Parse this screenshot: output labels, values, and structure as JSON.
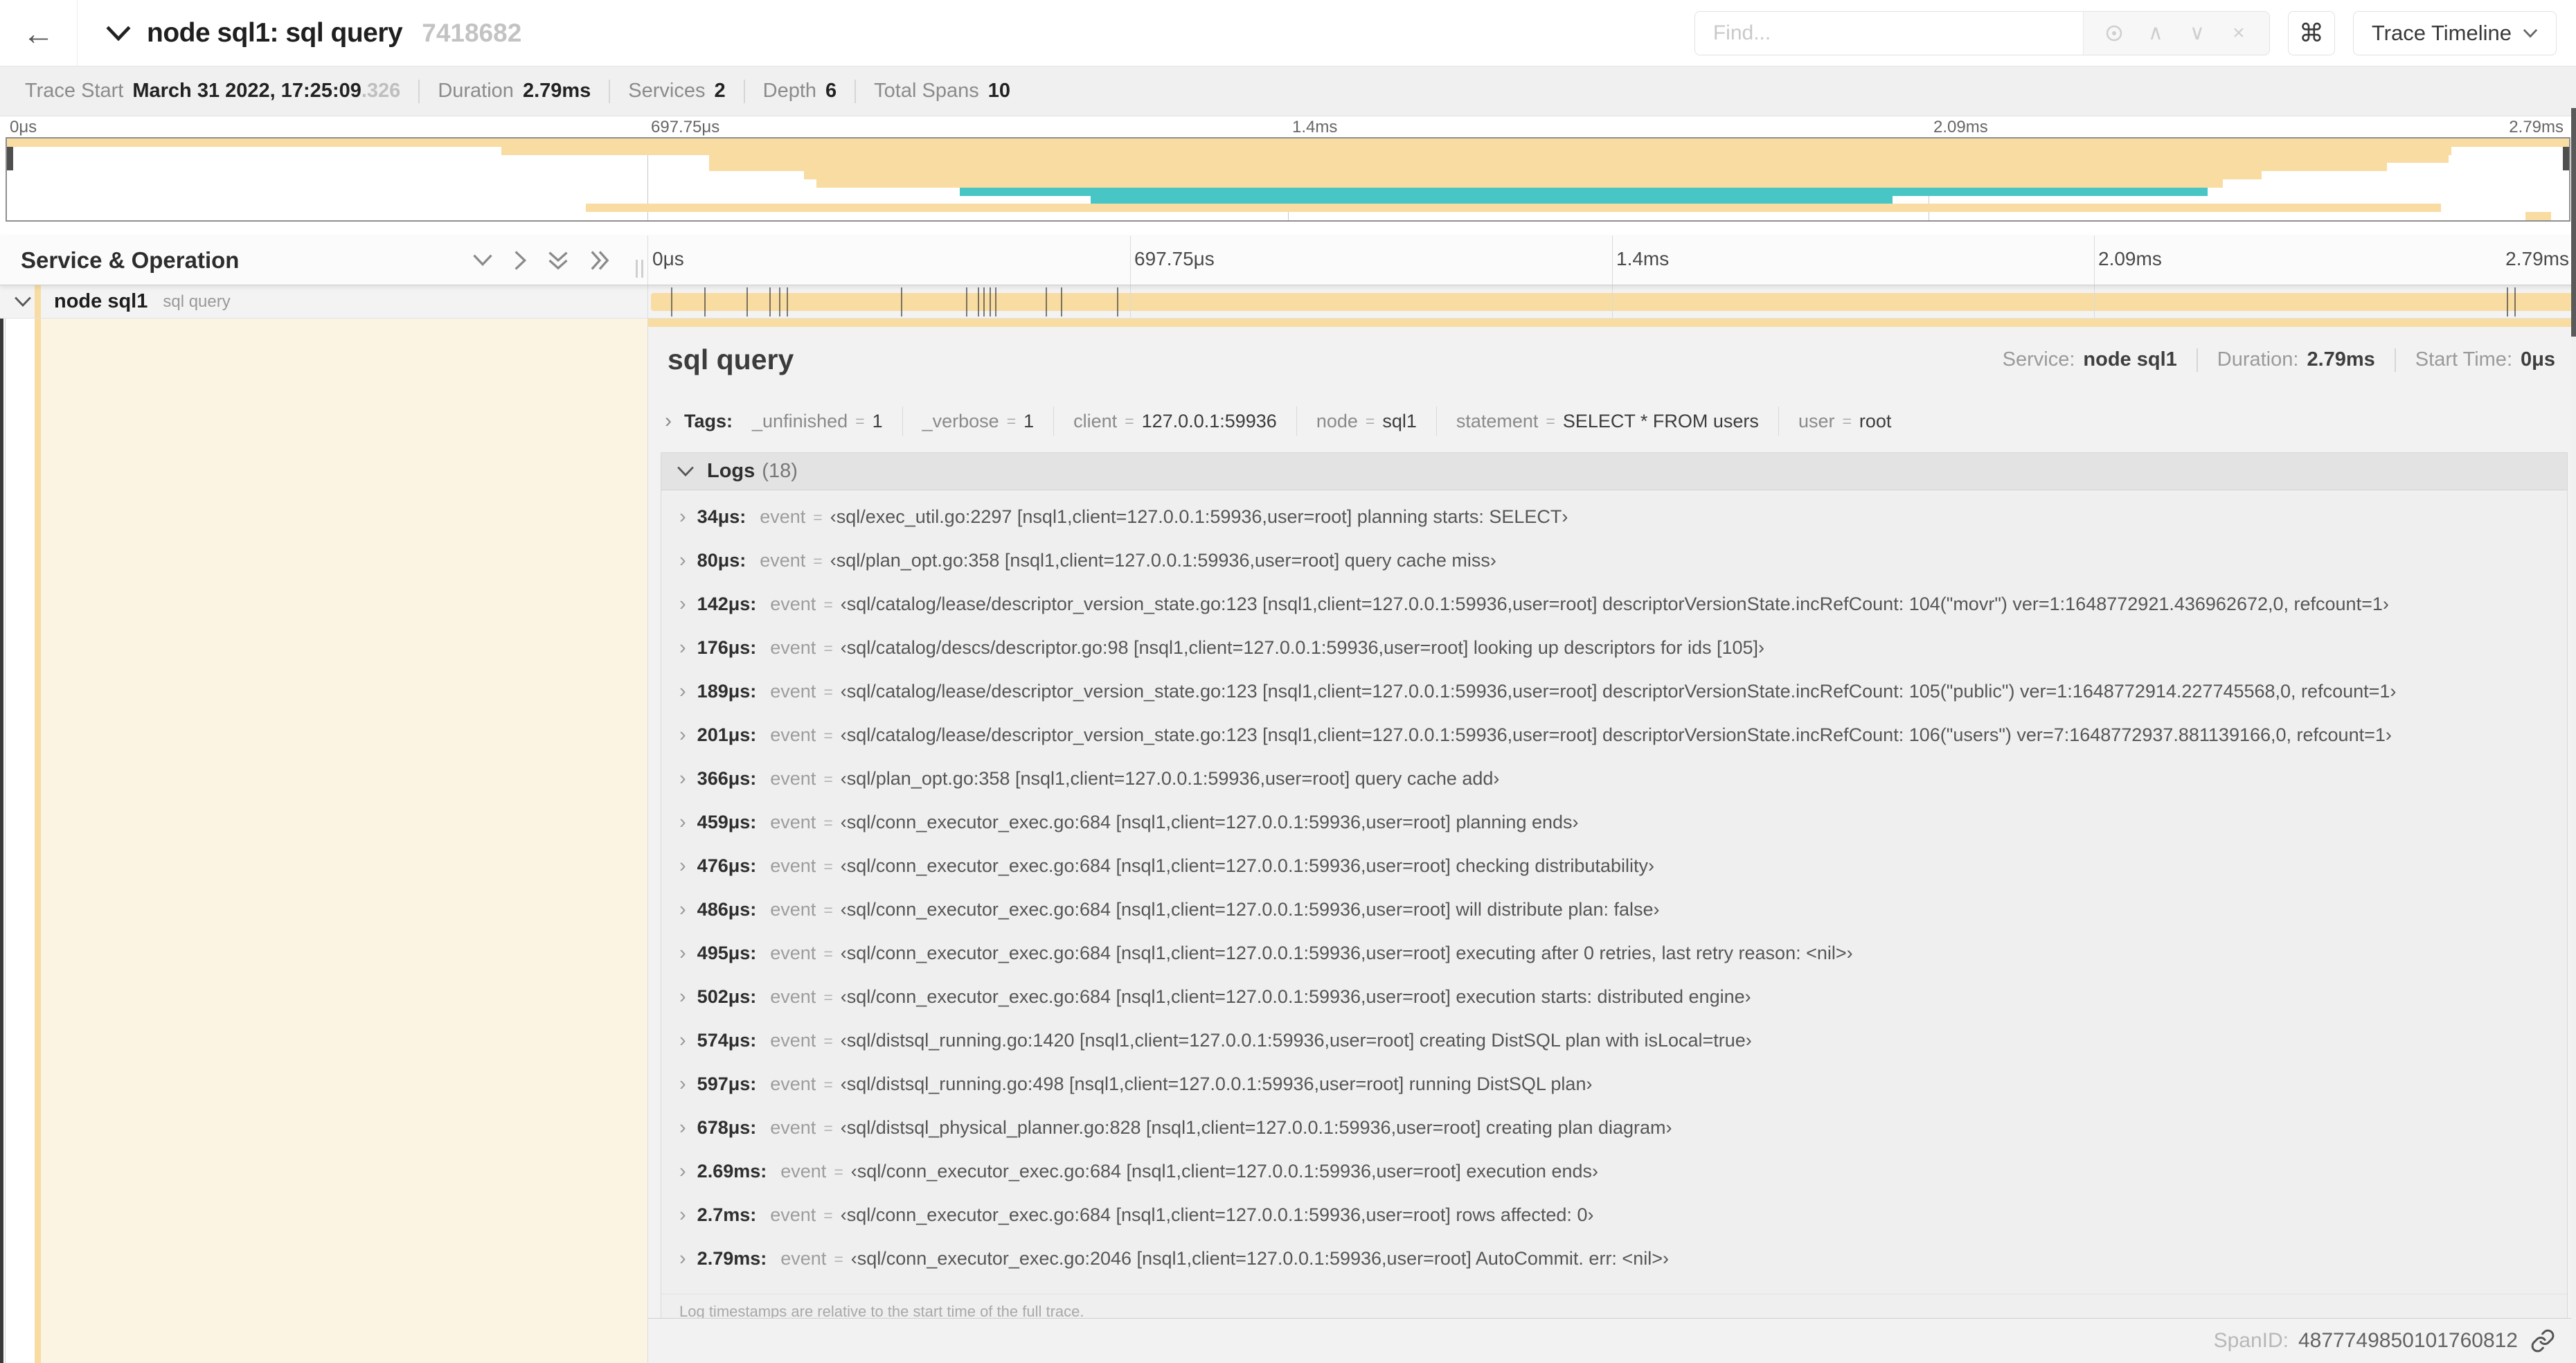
{
  "colors": {
    "span_tan": "#F8DCA2",
    "span_teal": "#48C5C5",
    "detail_cream": "#FBF4E3"
  },
  "header": {
    "back_icon": "←",
    "title": "node sql1: sql query",
    "trace_id": "7418682",
    "find_placeholder": "Find...",
    "search_prev_icon": "∧",
    "search_next_icon": "∨",
    "clear_search_icon": "×",
    "command_icon": "⌘",
    "view_selector": "Trace Timeline"
  },
  "trace_summary": {
    "items": [
      {
        "label": "Trace Start",
        "value": "March 31 2022, 17:25:09",
        "suffix": ".326"
      },
      {
        "label": "Duration",
        "value": "2.79ms",
        "suffix": ""
      },
      {
        "label": "Services",
        "value": "2",
        "suffix": ""
      },
      {
        "label": "Depth",
        "value": "6",
        "suffix": ""
      },
      {
        "label": "Total Spans",
        "value": "10",
        "suffix": ""
      }
    ]
  },
  "minimap": {
    "ticks": [
      {
        "label": "0μs",
        "pct": 0,
        "align": "left"
      },
      {
        "label": "697.75μs",
        "pct": 25,
        "align": "mid"
      },
      {
        "label": "1.4ms",
        "pct": 50,
        "align": "mid"
      },
      {
        "label": "2.09ms",
        "pct": 75,
        "align": "mid"
      },
      {
        "label": "2.79ms",
        "pct": 100,
        "align": "right"
      }
    ],
    "gridline_pcts": [
      25,
      50,
      75
    ],
    "spans": [
      {
        "start": 0,
        "end": 100,
        "color": "span_tan"
      },
      {
        "start": 19.3,
        "end": 95.4,
        "color": "span_tan"
      },
      {
        "start": 27.4,
        "end": 95.3,
        "color": "span_tan"
      },
      {
        "start": 27.4,
        "end": 92.9,
        "color": "span_tan"
      },
      {
        "start": 31.1,
        "end": 88.0,
        "color": "span_tan"
      },
      {
        "start": 31.6,
        "end": 86.5,
        "color": "span_tan"
      },
      {
        "start": 37.2,
        "end": 85.9,
        "color": "span_teal"
      },
      {
        "start": 42.3,
        "end": 73.6,
        "color": "span_teal"
      },
      {
        "start": 22.6,
        "end": 95.0,
        "color": "span_tan"
      },
      {
        "start": 98.3,
        "end": 99.3,
        "color": "span_tan"
      }
    ]
  },
  "timeline": {
    "column_title": "Service & Operation",
    "ticks": [
      {
        "label": "0μs",
        "pct": 0,
        "align": "left"
      },
      {
        "label": "697.75μs",
        "pct": 25,
        "align": "mid"
      },
      {
        "label": "1.4ms",
        "pct": 50,
        "align": "mid"
      },
      {
        "label": "2.09ms",
        "pct": 75,
        "align": "mid"
      },
      {
        "label": "2.79ms",
        "pct": 100,
        "align": "right"
      }
    ],
    "gridline_pcts": [
      25,
      50,
      75
    ]
  },
  "span_row": {
    "service": "node sql1",
    "operation": "sql query",
    "log_tick_pcts": [
      1.2,
      2.9,
      5.1,
      6.3,
      6.8,
      7.2,
      13.1,
      16.5,
      17.1,
      17.4,
      17.7,
      18.0,
      20.6,
      21.4,
      24.3,
      96.4,
      96.8
    ]
  },
  "detail": {
    "title": "sql query",
    "meta": [
      {
        "label": "Service:",
        "value": "node sql1"
      },
      {
        "label": "Duration:",
        "value": "2.79ms"
      },
      {
        "label": "Start Time:",
        "value": "0μs"
      }
    ],
    "tags_label": "Tags:",
    "equals_sign": "=",
    "tags": [
      {
        "key": "_unfinished",
        "value": "1"
      },
      {
        "key": "_verbose",
        "value": "1"
      },
      {
        "key": "client",
        "value": "127.0.0.1:59936"
      },
      {
        "key": "node",
        "value": "sql1"
      },
      {
        "key": "statement",
        "value": "SELECT * FROM users"
      },
      {
        "key": "user",
        "value": "root"
      }
    ],
    "logs_label": "Logs",
    "logs_count": "(18)",
    "log_field_label": "event",
    "logs": [
      {
        "time": "34μs:",
        "value": "‹sql/exec_util.go:2297 [nsql1,client=127.0.0.1:59936,user=root] planning starts: SELECT›"
      },
      {
        "time": "80μs:",
        "value": "‹sql/plan_opt.go:358 [nsql1,client=127.0.0.1:59936,user=root] query cache miss›"
      },
      {
        "time": "142μs:",
        "value": "‹sql/catalog/lease/descriptor_version_state.go:123 [nsql1,client=127.0.0.1:59936,user=root] descriptorVersionState.incRefCount: 104(\"movr\") ver=1:1648772921.436962672,0, refcount=1›"
      },
      {
        "time": "176μs:",
        "value": "‹sql/catalog/descs/descriptor.go:98 [nsql1,client=127.0.0.1:59936,user=root] looking up descriptors for ids [105]›"
      },
      {
        "time": "189μs:",
        "value": "‹sql/catalog/lease/descriptor_version_state.go:123 [nsql1,client=127.0.0.1:59936,user=root] descriptorVersionState.incRefCount: 105(\"public\") ver=1:1648772914.227745568,0, refcount=1›"
      },
      {
        "time": "201μs:",
        "value": "‹sql/catalog/lease/descriptor_version_state.go:123 [nsql1,client=127.0.0.1:59936,user=root] descriptorVersionState.incRefCount: 106(\"users\") ver=7:1648772937.881139166,0, refcount=1›"
      },
      {
        "time": "366μs:",
        "value": "‹sql/plan_opt.go:358 [nsql1,client=127.0.0.1:59936,user=root] query cache add›"
      },
      {
        "time": "459μs:",
        "value": "‹sql/conn_executor_exec.go:684 [nsql1,client=127.0.0.1:59936,user=root] planning ends›"
      },
      {
        "time": "476μs:",
        "value": "‹sql/conn_executor_exec.go:684 [nsql1,client=127.0.0.1:59936,user=root] checking distributability›"
      },
      {
        "time": "486μs:",
        "value": "‹sql/conn_executor_exec.go:684 [nsql1,client=127.0.0.1:59936,user=root] will distribute plan: false›"
      },
      {
        "time": "495μs:",
        "value": "‹sql/conn_executor_exec.go:684 [nsql1,client=127.0.0.1:59936,user=root] executing after 0 retries, last retry reason: <nil>›"
      },
      {
        "time": "502μs:",
        "value": "‹sql/conn_executor_exec.go:684 [nsql1,client=127.0.0.1:59936,user=root] execution starts: distributed engine›"
      },
      {
        "time": "574μs:",
        "value": "‹sql/distsql_running.go:1420 [nsql1,client=127.0.0.1:59936,user=root] creating DistSQL plan with isLocal=true›"
      },
      {
        "time": "597μs:",
        "value": "‹sql/distsql_running.go:498 [nsql1,client=127.0.0.1:59936,user=root] running DistSQL plan›"
      },
      {
        "time": "678μs:",
        "value": "‹sql/distsql_physical_planner.go:828 [nsql1,client=127.0.0.1:59936,user=root] creating plan diagram›"
      },
      {
        "time": "2.69ms:",
        "value": "‹sql/conn_executor_exec.go:684 [nsql1,client=127.0.0.1:59936,user=root] execution ends›"
      },
      {
        "time": "2.7ms:",
        "value": "‹sql/conn_executor_exec.go:684 [nsql1,client=127.0.0.1:59936,user=root] rows affected: 0›"
      },
      {
        "time": "2.79ms:",
        "value": "‹sql/conn_executor_exec.go:2046 [nsql1,client=127.0.0.1:59936,user=root] AutoCommit. err: <nil>›"
      }
    ],
    "footer_note": "Log timestamps are relative to the start time of the full trace.",
    "span_id_label": "SpanID:",
    "span_id": "4877749850101760812"
  }
}
